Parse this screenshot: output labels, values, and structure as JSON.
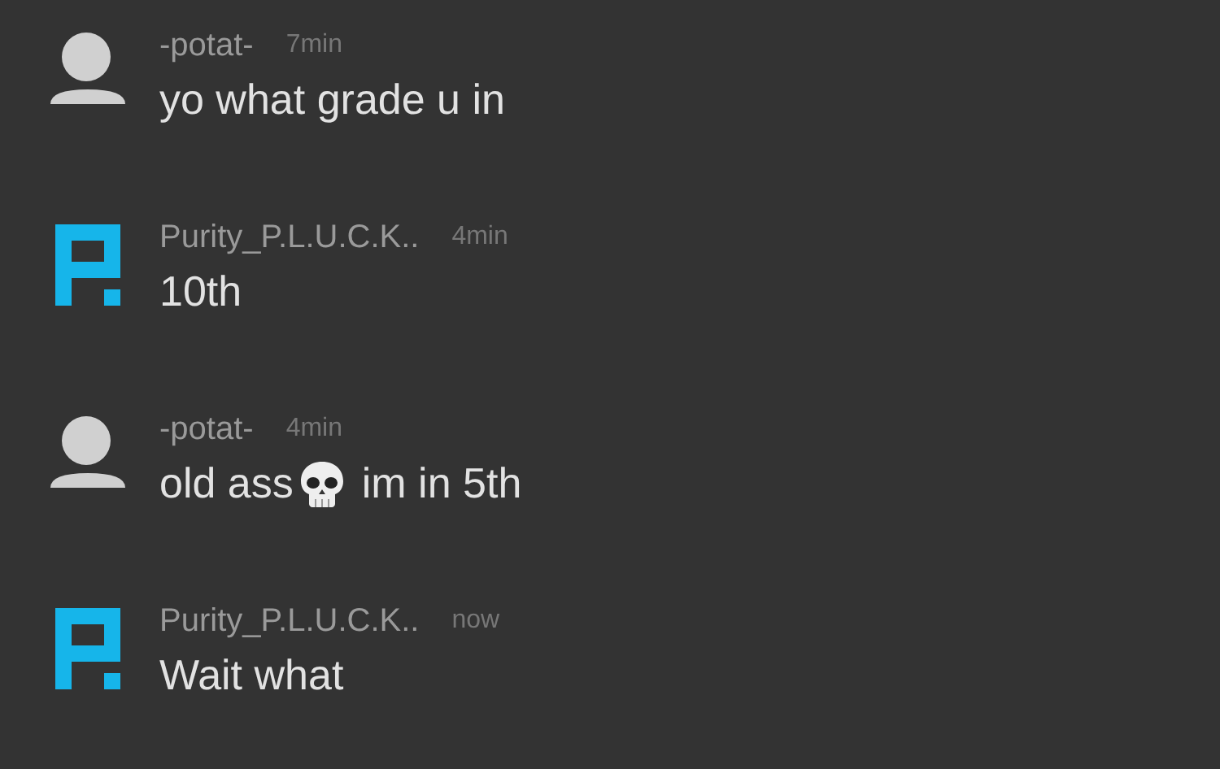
{
  "messages": [
    {
      "avatar": {
        "kind": "default"
      },
      "name": "-potat-",
      "time": "7min",
      "parts": [
        {
          "kind": "text",
          "text": "yo what grade u in"
        }
      ]
    },
    {
      "avatar": {
        "kind": "logo"
      },
      "name": "Purity_P.L.U.C.K..",
      "time": "4min",
      "parts": [
        {
          "kind": "text",
          "text": "10th"
        }
      ]
    },
    {
      "avatar": {
        "kind": "default"
      },
      "name": "-potat-",
      "time": "4min",
      "parts": [
        {
          "kind": "text",
          "text": "old ass"
        },
        {
          "kind": "skull"
        },
        {
          "kind": "text",
          "text": "im in 5th"
        }
      ]
    },
    {
      "avatar": {
        "kind": "logo"
      },
      "name": "Purity_P.L.U.C.K..",
      "time": "now",
      "parts": [
        {
          "kind": "text",
          "text": "Wait what"
        }
      ]
    }
  ]
}
